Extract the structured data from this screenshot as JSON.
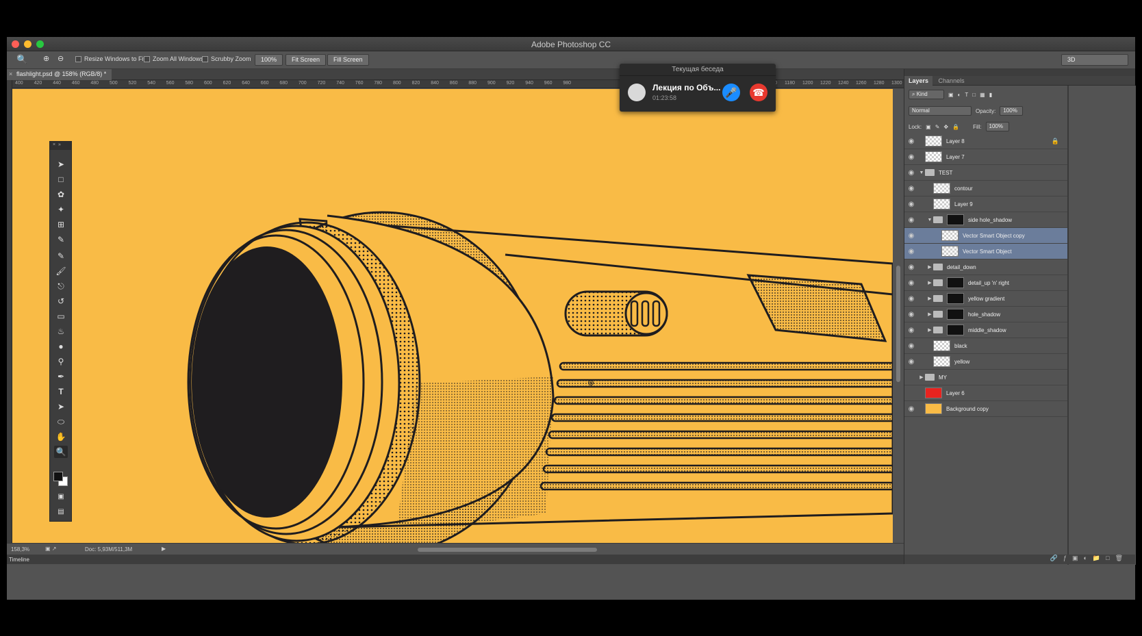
{
  "app": {
    "title": "Adobe Photoshop CC"
  },
  "options_bar": {
    "resize_windows": "Resize Windows to Fit",
    "zoom_all": "Zoom All Windows",
    "scrubby_zoom": "Scrubby Zoom",
    "zoom_value": "100%",
    "fit_screen": "Fit Screen",
    "fill_screen": "Fill Screen",
    "workspace": "3D"
  },
  "document": {
    "tab_label": "flashlight.psd @ 158% (RGB/8) *"
  },
  "ruler_labels": [
    "400",
    "420",
    "440",
    "460",
    "480",
    "500",
    "520",
    "540",
    "560",
    "580",
    "600",
    "620",
    "640",
    "660",
    "680",
    "700",
    "720",
    "740",
    "760",
    "780",
    "800",
    "820",
    "840",
    "860",
    "880",
    "900",
    "920",
    "940",
    "960",
    "980",
    "1140",
    "1150",
    "1160",
    "1180",
    "1200",
    "1220",
    "1240",
    "1260",
    "1280",
    "1300"
  ],
  "status": {
    "zoom": "158,3%",
    "doc": "Doc: 5,93M/511,3M",
    "timeline": "Timeline"
  },
  "call": {
    "header": "Текущая беседа",
    "name": "Лекция по Объ...",
    "time": "01:23:58"
  },
  "panel": {
    "tab_layers": "Layers",
    "tab_channels": "Channels",
    "kind": "Kind",
    "blend_mode": "Normal",
    "opacity_label": "Opacity:",
    "opacity_value": "100%",
    "lock_label": "Lock:",
    "fill_label": "Fill:",
    "fill_value": "100%"
  },
  "layers": [
    {
      "name": "Layer 8",
      "kind": "pixel",
      "indent": 0,
      "visible": true,
      "locked": true
    },
    {
      "name": "Layer 7",
      "kind": "pixel",
      "indent": 0,
      "visible": true
    },
    {
      "name": "TEST",
      "kind": "group",
      "indent": 0,
      "visible": true,
      "open": true
    },
    {
      "name": "contour",
      "kind": "smart",
      "indent": 1,
      "visible": true
    },
    {
      "name": "Layer 9",
      "kind": "pixel",
      "indent": 1,
      "visible": true
    },
    {
      "name": "side hole_shadow",
      "kind": "group-mask",
      "indent": 1,
      "visible": true,
      "open": true
    },
    {
      "name": "Vector Smart Object copy",
      "kind": "smart",
      "indent": 2,
      "visible": true,
      "selected": true
    },
    {
      "name": "Vector Smart Object",
      "kind": "smart",
      "indent": 2,
      "visible": true,
      "selected": true
    },
    {
      "name": "detail_down",
      "kind": "group",
      "indent": 1,
      "visible": true
    },
    {
      "name": "detail_up 'n' right",
      "kind": "group-mask",
      "indent": 1,
      "visible": true
    },
    {
      "name": "yellow gradient",
      "kind": "group-mask",
      "indent": 1,
      "visible": true
    },
    {
      "name": "hole_shadow",
      "kind": "group-mask",
      "indent": 1,
      "visible": true
    },
    {
      "name": "middle_shadow",
      "kind": "group-mask",
      "indent": 1,
      "visible": true
    },
    {
      "name": "black",
      "kind": "smart",
      "indent": 1,
      "visible": true
    },
    {
      "name": "yellow",
      "kind": "smart",
      "indent": 1,
      "visible": true
    },
    {
      "name": "MY",
      "kind": "group",
      "indent": 0,
      "visible": false
    },
    {
      "name": "Layer 6",
      "kind": "color",
      "color": "#e8231f",
      "indent": 0,
      "visible": false
    },
    {
      "name": "Background copy",
      "kind": "color",
      "color": "#f9bb46",
      "indent": 0,
      "visible": true
    }
  ],
  "colors": {
    "canvas": "#f9bb46",
    "ink": "#1f1d1f",
    "selection": "#6b7d9b"
  }
}
